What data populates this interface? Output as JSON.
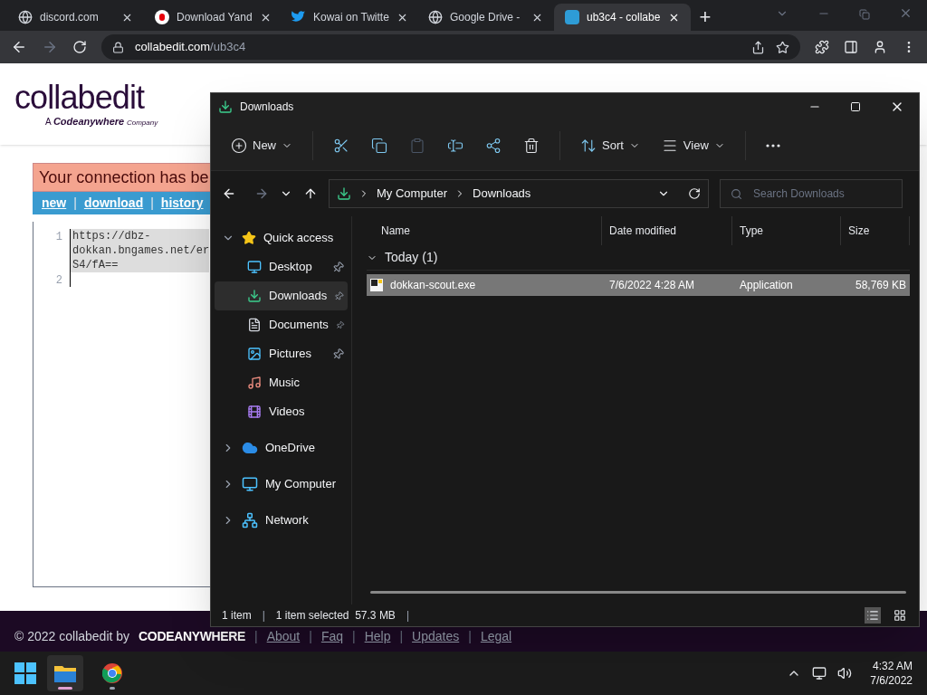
{
  "browser": {
    "tabs": [
      {
        "title": "discord.com",
        "kind": "globe",
        "selected": false
      },
      {
        "title": "Download Yand",
        "kind": "yandex",
        "selected": false
      },
      {
        "title": "Kowai on Twitte",
        "kind": "bird",
        "selected": false
      },
      {
        "title": "Google Drive -",
        "kind": "globe",
        "selected": false
      },
      {
        "title": "ub3c4 - collabe",
        "kind": "ce",
        "selected": true
      }
    ],
    "new_tab": "+",
    "url_host": "collabedit.com",
    "url_path": "/ub3c4"
  },
  "page": {
    "logo": "collabedit",
    "tagline_prefix": "A",
    "tagline_brand": "Codeanywhere",
    "tagline_suffix": "Company",
    "banner": "Your connection has be",
    "links": [
      "new",
      "download",
      "history"
    ],
    "link_separators": [
      "|",
      "|"
    ],
    "editor": {
      "lines": [
        {
          "number": "1",
          "text": "https://dbz-\ndokkan.bngames.net/er\nS4/fA=="
        },
        {
          "number": "2"
        }
      ]
    },
    "footer": {
      "copyright": "© 2022 collabedit by",
      "brand": "CODEANYWHERE",
      "separators": [
        "|",
        "|",
        "|",
        "|",
        "|"
      ],
      "links": [
        "About",
        "Faq",
        "Help",
        "Updates",
        "Legal"
      ]
    }
  },
  "explorer": {
    "title": "Downloads",
    "toolbar": [
      {
        "kind": "new",
        "label": "New"
      },
      {
        "kind": "cut"
      },
      {
        "kind": "copy"
      },
      {
        "kind": "paste",
        "disabled": true
      },
      {
        "kind": "rename"
      },
      {
        "kind": "share"
      },
      {
        "kind": "delete"
      },
      {
        "kind": "sort",
        "label": "Sort"
      },
      {
        "kind": "view",
        "label": "View"
      },
      {
        "kind": "more"
      }
    ],
    "breadcrumb": [
      "My Computer",
      "Downloads"
    ],
    "search": {
      "placeholder": "Search Downloads"
    },
    "sidebar": [
      {
        "label": "Quick access",
        "kind": "star",
        "expanded": true,
        "selected": false,
        "children": [
          {
            "label": "Desktop",
            "kind": "desktop",
            "pinned": true,
            "selected": false
          },
          {
            "label": "Downloads",
            "kind": "download",
            "pinned": true,
            "selected": true
          },
          {
            "label": "Documents",
            "kind": "document",
            "pinned": true,
            "selected": false
          },
          {
            "label": "Pictures",
            "kind": "picture",
            "pinned": true,
            "selected": false
          },
          {
            "label": "Music",
            "kind": "music",
            "pinned": false,
            "selected": false
          },
          {
            "label": "Videos",
            "kind": "video",
            "pinned": false,
            "selected": false
          }
        ]
      },
      {
        "label": "OneDrive",
        "kind": "cloud",
        "expanded": false,
        "selected": false
      },
      {
        "label": "My Computer",
        "kind": "computer",
        "expanded": false,
        "selected": false
      },
      {
        "label": "Network",
        "kind": "network",
        "expanded": false,
        "selected": false
      }
    ],
    "columns": [
      "Name",
      "Date modified",
      "Type",
      "Size"
    ],
    "groups": [
      {
        "label": "Today (1)",
        "expanded": true,
        "rows": [
          {
            "name": "dokkan-scout.exe",
            "date": "7/6/2022 4:28 AM",
            "type": "Application",
            "size": "58,769 KB",
            "selected": true
          }
        ]
      }
    ],
    "status": [
      "1 item",
      "1 item selected  57.3 MB"
    ],
    "status_separators": [
      "|",
      "|"
    ]
  },
  "taskbar": {
    "time": "4:32 AM",
    "date": "7/6/2022",
    "apps": [
      {
        "kind": "explorer",
        "active": true
      },
      {
        "kind": "chrome",
        "active": false
      }
    ]
  }
}
